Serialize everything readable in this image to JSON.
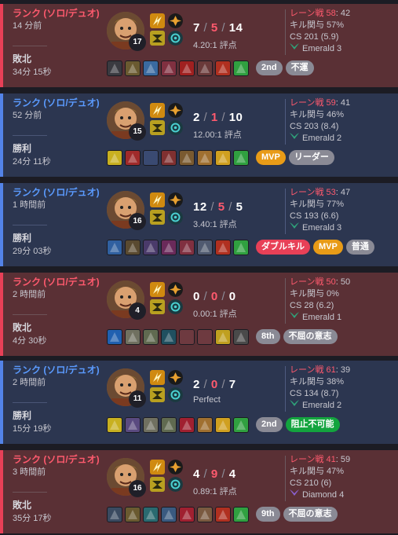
{
  "matches": [
    {
      "result_class": "loss",
      "queue": "ランク (ソロ/デュオ)",
      "time_ago": "14 分前",
      "result": "敗北",
      "duration": "34分 15秒",
      "level": "17",
      "kda": {
        "kills": "7",
        "deaths": "5",
        "assists": "14"
      },
      "kda_ratio": "4.20:1 評点",
      "lane_label": "レーン戦",
      "lane_score": "58",
      "lane_opp": ": 42",
      "kill_participation": "キル関与 57%",
      "cs": "CS 201 (5.9)",
      "rank": "Emerald 3",
      "rank_color": "#2fa37a",
      "items": [
        "#3a3a40",
        "#6a5a30",
        "#3a6aa0",
        "#803040",
        "#a02020",
        "#6a3a3a",
        "#b03020",
        "#30a040"
      ],
      "empty_slots": [],
      "badges": [
        {
          "label": "2nd",
          "style": "b-grey"
        },
        {
          "label": "不運",
          "style": "b-grey"
        }
      ]
    },
    {
      "result_class": "win",
      "queue": "ランク (ソロ/デュオ)",
      "time_ago": "52 分前",
      "result": "勝利",
      "duration": "24分 11秒",
      "level": "15",
      "kda": {
        "kills": "2",
        "deaths": "1",
        "assists": "10"
      },
      "kda_ratio": "12.00:1 評点",
      "lane_label": "レーン戦",
      "lane_score": "59",
      "lane_opp": ": 41",
      "kill_participation": "キル関与 46%",
      "cs": "CS 203 (8.4)",
      "rank": "Emerald 2",
      "rank_color": "#2fa37a",
      "items": [
        "#c8b020",
        "#a02a2a",
        "",
        "#803030",
        "#7a5a30",
        "#a07030",
        "#d0a020",
        "#30a040"
      ],
      "empty_slots": [
        2
      ],
      "badges": [
        {
          "label": "MVP",
          "style": "b-orange"
        },
        {
          "label": "リーダー",
          "style": "b-grey"
        }
      ]
    },
    {
      "result_class": "win",
      "queue": "ランク (ソロ/デュオ)",
      "time_ago": "1 時間前",
      "result": "勝利",
      "duration": "29分 03秒",
      "level": "16",
      "kda": {
        "kills": "12",
        "deaths": "5",
        "assists": "5"
      },
      "kda_ratio": "3.40:1 評点",
      "lane_label": "レーン戦",
      "lane_score": "53",
      "lane_opp": ": 47",
      "kill_participation": "キル関与 77%",
      "cs": "CS 193 (6.6)",
      "rank": "Emerald 3",
      "rank_color": "#2fa37a",
      "items": [
        "#3060a0",
        "#5a4a30",
        "#4a3a6a",
        "#6a2a5a",
        "#803040",
        "#505a70",
        "#b03020",
        "#30a040"
      ],
      "empty_slots": [],
      "badges": [
        {
          "label": "ダブルキル",
          "style": "b-red"
        },
        {
          "label": "MVP",
          "style": "b-orange"
        },
        {
          "label": "普通",
          "style": "b-grey"
        }
      ]
    },
    {
      "result_class": "loss",
      "queue": "ランク (ソロ/デュオ)",
      "time_ago": "2 時間前",
      "result": "敗北",
      "duration": "4分 30秒",
      "level": "4",
      "kda": {
        "kills": "0",
        "deaths": "0",
        "assists": "0"
      },
      "kda_ratio": "0.00:1 評点",
      "lane_label": "レーン戦",
      "lane_score": "50",
      "lane_opp": ": 50",
      "kill_participation": "キル関与 0%",
      "cs": "CS 28 (6.2)",
      "rank": "Emerald 1",
      "rank_color": "#2fa37a",
      "items": [
        "#2060b0",
        "#707060",
        "#606a50",
        "#205060",
        "",
        "",
        "#c0a020",
        "#4a4a4a"
      ],
      "empty_slots": [
        4,
        5
      ],
      "badges": [
        {
          "label": "8th",
          "style": "b-grey"
        },
        {
          "label": "不屈の意志",
          "style": "b-grey"
        }
      ]
    },
    {
      "result_class": "win",
      "queue": "ランク (ソロ/デュオ)",
      "time_ago": "2 時間前",
      "result": "勝利",
      "duration": "15分 19秒",
      "level": "11",
      "kda": {
        "kills": "2",
        "deaths": "0",
        "assists": "7"
      },
      "kda_ratio": "Perfect",
      "lane_label": "レーン戦",
      "lane_score": "61",
      "lane_opp": ": 39",
      "kill_participation": "キル関与 38%",
      "cs": "CS 134 (8.7)",
      "rank": "Emerald 2",
      "rank_color": "#2fa37a",
      "items": [
        "#c8b020",
        "#5a4a80",
        "#707060",
        "#606a50",
        "#a02030",
        "#a07030",
        "#d0a020",
        "#30a040"
      ],
      "empty_slots": [],
      "badges": [
        {
          "label": "2nd",
          "style": "b-grey"
        },
        {
          "label": "阻止不可能",
          "style": "b-green"
        }
      ]
    },
    {
      "result_class": "loss",
      "queue": "ランク (ソロ/デュオ)",
      "time_ago": "3 時間前",
      "result": "敗北",
      "duration": "35分 17秒",
      "level": "16",
      "kda": {
        "kills": "4",
        "deaths": "9",
        "assists": "4"
      },
      "kda_ratio": "0.89:1 評点",
      "lane_label": "レーン戦",
      "lane_score": "41",
      "lane_opp": ": 59",
      "kill_participation": "キル関与 47%",
      "cs": "CS 210 (6)",
      "rank": "Diamond 4",
      "rank_color": "#8a60d0",
      "items": [
        "#3a4a60",
        "#6a5a30",
        "#2a6a70",
        "#3a5a80",
        "#a02030",
        "#7a5a40",
        "#b03020",
        "#30a040"
      ],
      "empty_slots": [],
      "badges": [
        {
          "label": "9th",
          "style": "b-grey"
        },
        {
          "label": "不屈の意志",
          "style": "b-grey"
        }
      ]
    }
  ]
}
